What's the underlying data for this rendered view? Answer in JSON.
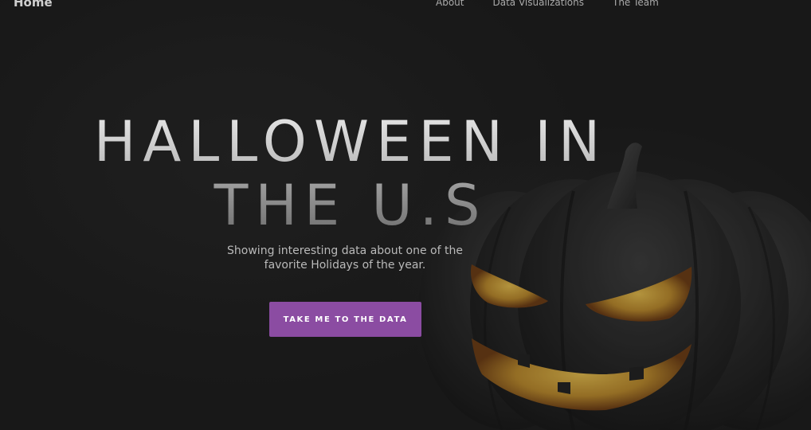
{
  "nav": {
    "home_label": "Home",
    "links": [
      {
        "label": "About"
      },
      {
        "label": "Data Visualizations"
      },
      {
        "label": "The Team"
      }
    ]
  },
  "hero": {
    "title": "HALLOWEEN IN THE U.S",
    "subtitle": "Showing interesting data about one of the favorite Holidays of the year.",
    "cta_label": "TAKE ME TO THE DATA",
    "background_image": "jack-o-lantern pumpkin",
    "colors": {
      "accent": "#8b4ca2",
      "background": "#1b1b1b",
      "glow": "#c9a23a"
    }
  }
}
